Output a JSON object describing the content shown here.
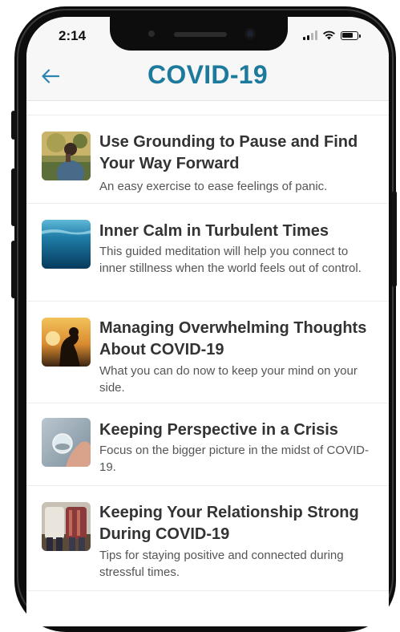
{
  "status_bar": {
    "time": "2:14",
    "battery_level": 0.75
  },
  "header": {
    "title": "COVID-19"
  },
  "articles": [
    {
      "title": "Use Grounding to Pause and Find Your Way Forward",
      "description": "An easy exercise to ease feelings of panic.",
      "image": "person-in-nature-photo"
    },
    {
      "title": "Inner Calm in Turbulent Times",
      "description": "This guided meditation will help you connect to inner stillness when the world feels out of control.",
      "image": "underwater-ocean-photo"
    },
    {
      "title": "Managing Overwhelming Thoughts About COVID-19",
      "description": "What you can do now to keep your mind on your side.",
      "image": "silhouette-sunset-photo"
    },
    {
      "title": "Keeping Perspective in a Crisis",
      "description": "Focus on the bigger picture in the midst of COVID-19.",
      "image": "hand-holding-glass-ball-photo"
    },
    {
      "title": "Keeping Your Relationship Strong During COVID-19",
      "description": "Tips for staying positive and connected during stressful times.",
      "image": "couple-photo"
    }
  ],
  "colors": {
    "title": "#1d7a9c",
    "back_arrow": "#2a86b0",
    "text": "#333333"
  }
}
